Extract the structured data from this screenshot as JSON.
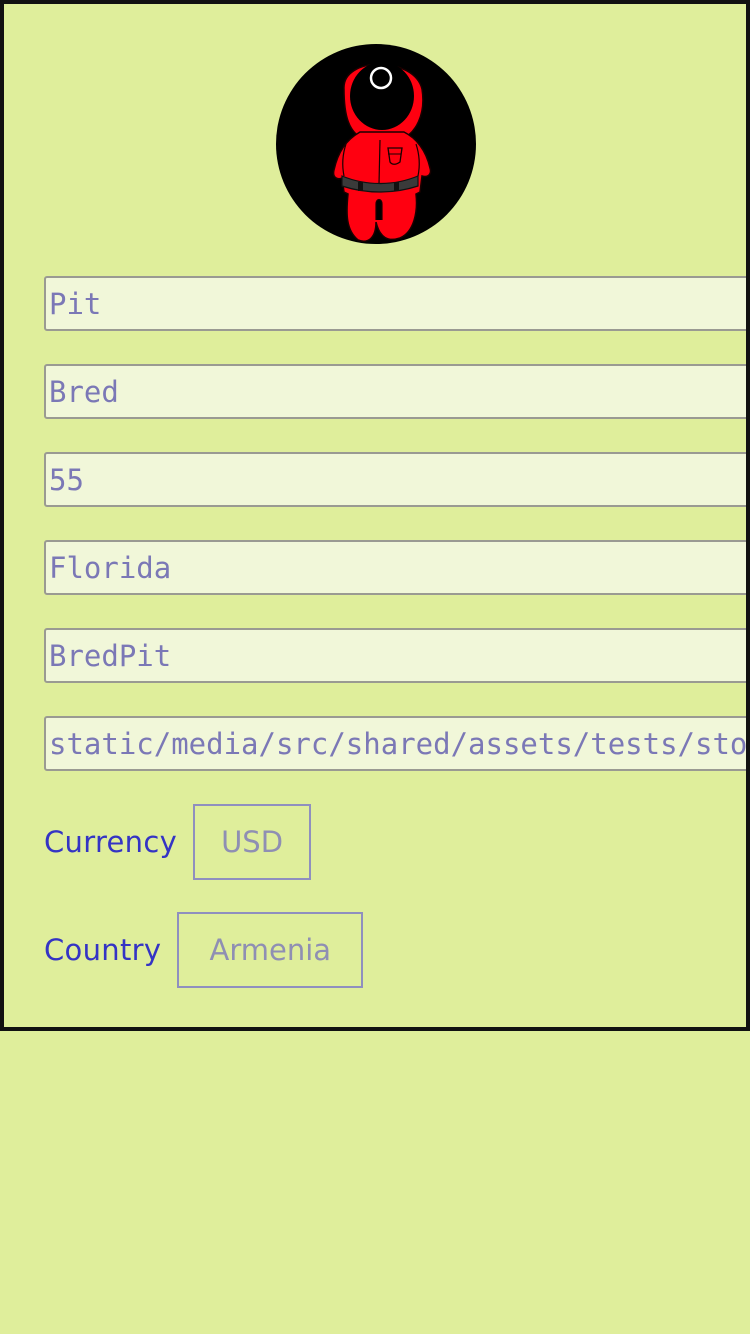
{
  "profile": {
    "avatar_icon": "masked-guard-avatar",
    "fields": [
      {
        "key": "first_name",
        "value": "Pit"
      },
      {
        "key": "last_name",
        "value": "Bred"
      },
      {
        "key": "age",
        "value": "55"
      },
      {
        "key": "city",
        "value": "Florida"
      },
      {
        "key": "username",
        "value": "BredPit"
      },
      {
        "key": "avatar_path",
        "value": "static/media/src/shared/assets/tests/storybook.jpg"
      }
    ]
  },
  "currency": {
    "label": "Currency",
    "value": "USD"
  },
  "country": {
    "label": "Country",
    "value": "Armenia"
  },
  "colors": {
    "background": "#dfee9b",
    "frame_border": "#111111",
    "input_background": "#f1f7d9",
    "input_text": "#7b78b6",
    "label_text": "#3434c4",
    "avatar_red": "#ff0000"
  }
}
